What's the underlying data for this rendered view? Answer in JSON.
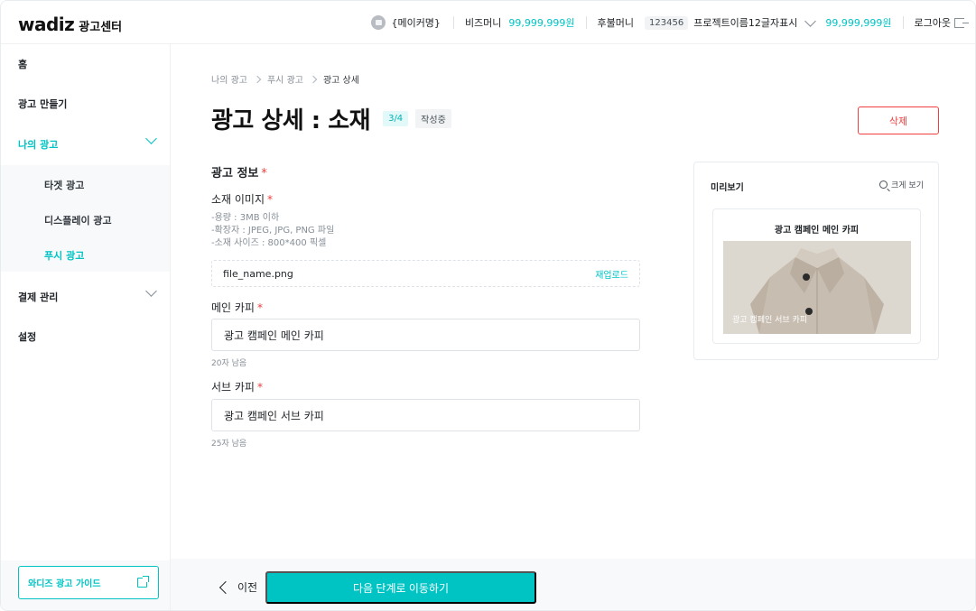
{
  "header": {
    "logo": "wadiz",
    "logo_sub": "광고센터",
    "maker_name": "{메이커명}",
    "biz_money_label": "비즈머니",
    "biz_money_value": "99,999,999원",
    "postpaid_label": "후불머니",
    "project_id": "123456",
    "project_name": "프로젝트이름12글자표시",
    "project_money": "99,999,999원",
    "logout_label": "로그아웃"
  },
  "sidebar": {
    "items": [
      {
        "label": "홈"
      },
      {
        "label": "광고 만들기"
      },
      {
        "label": "나의 광고"
      },
      {
        "label": "결제 관리"
      },
      {
        "label": "설정"
      }
    ],
    "sub_items": [
      {
        "label": "타겟 광고"
      },
      {
        "label": "디스플레이 광고"
      },
      {
        "label": "푸시 광고"
      }
    ],
    "guide_label": "와디즈 광고 가이드"
  },
  "breadcrumb": [
    "나의 광고",
    "푸시 광고",
    "광고 상세"
  ],
  "page": {
    "title": "광고 상세 : 소재",
    "step": "3/4",
    "status": "작성중",
    "delete_label": "삭제"
  },
  "form": {
    "section_title": "광고 정보",
    "required_mark": "*",
    "image_label": "소재 이미지",
    "image_guides": [
      "-용량 : 3MB 이하",
      "-확장자 : JPEG, JPG, PNG 파일",
      "-소재 사이즈 : 800*400 픽셀"
    ],
    "file_name": "file_name.png",
    "reupload_label": "재업로드",
    "main_copy_label": "메인 카피",
    "main_copy_value": "광고 캠페인 메인 카피",
    "main_copy_hint": "20자 남음",
    "sub_copy_label": "서브 카피",
    "sub_copy_value": "광고 캠페인 서브 카피",
    "sub_copy_hint": "25자 남음"
  },
  "preview": {
    "title": "미리보기",
    "zoom_label": "크게 보기",
    "push_title": "광고 캠페인 메인 카피",
    "push_sub": "광고 캠페인 서브 카피"
  },
  "footer": {
    "prev_label": "이전",
    "next_label": "다음 단계로 이동하기"
  },
  "colors": {
    "accent": "#00c4c4",
    "danger": "#f03e3e"
  }
}
